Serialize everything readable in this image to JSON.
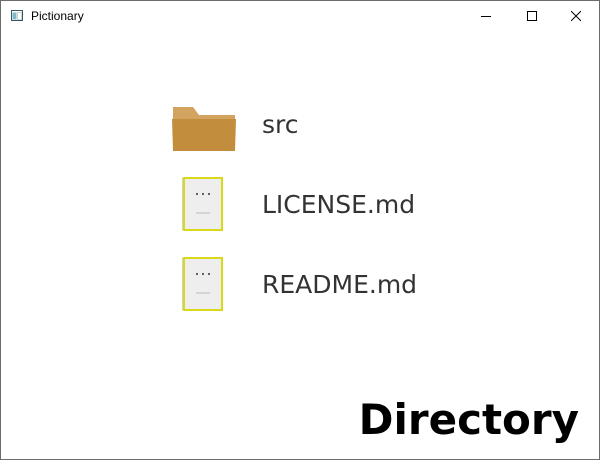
{
  "window": {
    "title": "Pictionary",
    "controls": [
      "minimize",
      "maximize",
      "close"
    ]
  },
  "entries": [
    {
      "label": "src",
      "icon": "folder-icon"
    },
    {
      "label": "LICENSE.md",
      "icon": "file-icon"
    },
    {
      "label": "README.md",
      "icon": "file-icon"
    }
  ],
  "footer": {
    "title": "Directory"
  },
  "colors": {
    "folder": "#c28e3e",
    "folder_tab": "#d3a460",
    "file_border": "#d9d91a",
    "file_fill": "#eeeeee",
    "label_text": "#333333"
  }
}
